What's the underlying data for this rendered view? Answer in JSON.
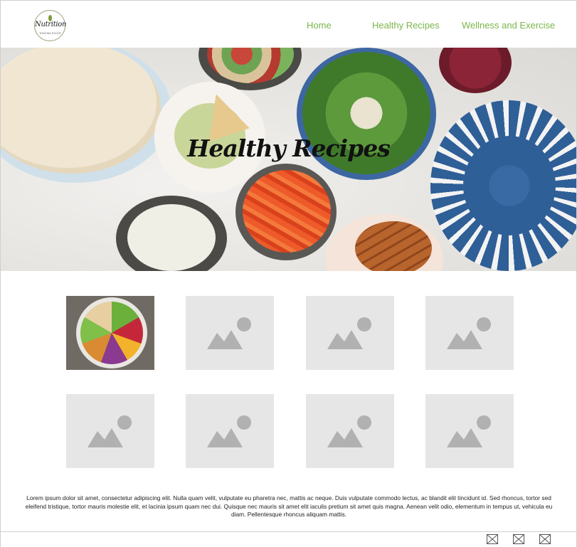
{
  "header": {
    "logo_text": "Nutrition",
    "logo_subtext": "KNOWLEDGE",
    "nav": [
      {
        "label": "Home"
      },
      {
        "label": "Healthy Recipes"
      },
      {
        "label": "Wellness and Exercise"
      }
    ]
  },
  "hero": {
    "title": "Healthy Recipes"
  },
  "gallery": {
    "items": [
      {
        "icon": "food-bowl-image"
      },
      {
        "icon": "image-placeholder-icon"
      },
      {
        "icon": "image-placeholder-icon"
      },
      {
        "icon": "image-placeholder-icon"
      },
      {
        "icon": "image-placeholder-icon"
      },
      {
        "icon": "image-placeholder-icon"
      },
      {
        "icon": "image-placeholder-icon"
      },
      {
        "icon": "image-placeholder-icon"
      }
    ]
  },
  "body_text": "Lorem ipsum dolor sit amet, consectetur adipiscing elit. Nulla quam velit, vulputate eu pharetra nec, mattis ac neque. Duis vulputate commodo lectus, ac blandit elit tincidunt id. Sed rhoncus, tortor sed eleifend tristique, tortor mauris molestie elit, et lacinia ipsum quam nec dui. Quisque nec mauris sit amet elit iaculis pretium sit amet quis magna. Aenean velit odio, elementum in tempus ut, vehicula eu diam. Pellentesque rhoncus aliquam mattis.",
  "footer": {
    "icons": [
      "placeholder-x-icon",
      "placeholder-x-icon",
      "placeholder-x-icon"
    ]
  },
  "colors": {
    "nav_link": "#7bb54a",
    "placeholder_bg": "#e6e6e6",
    "placeholder_glyph": "#b1b1b1"
  }
}
